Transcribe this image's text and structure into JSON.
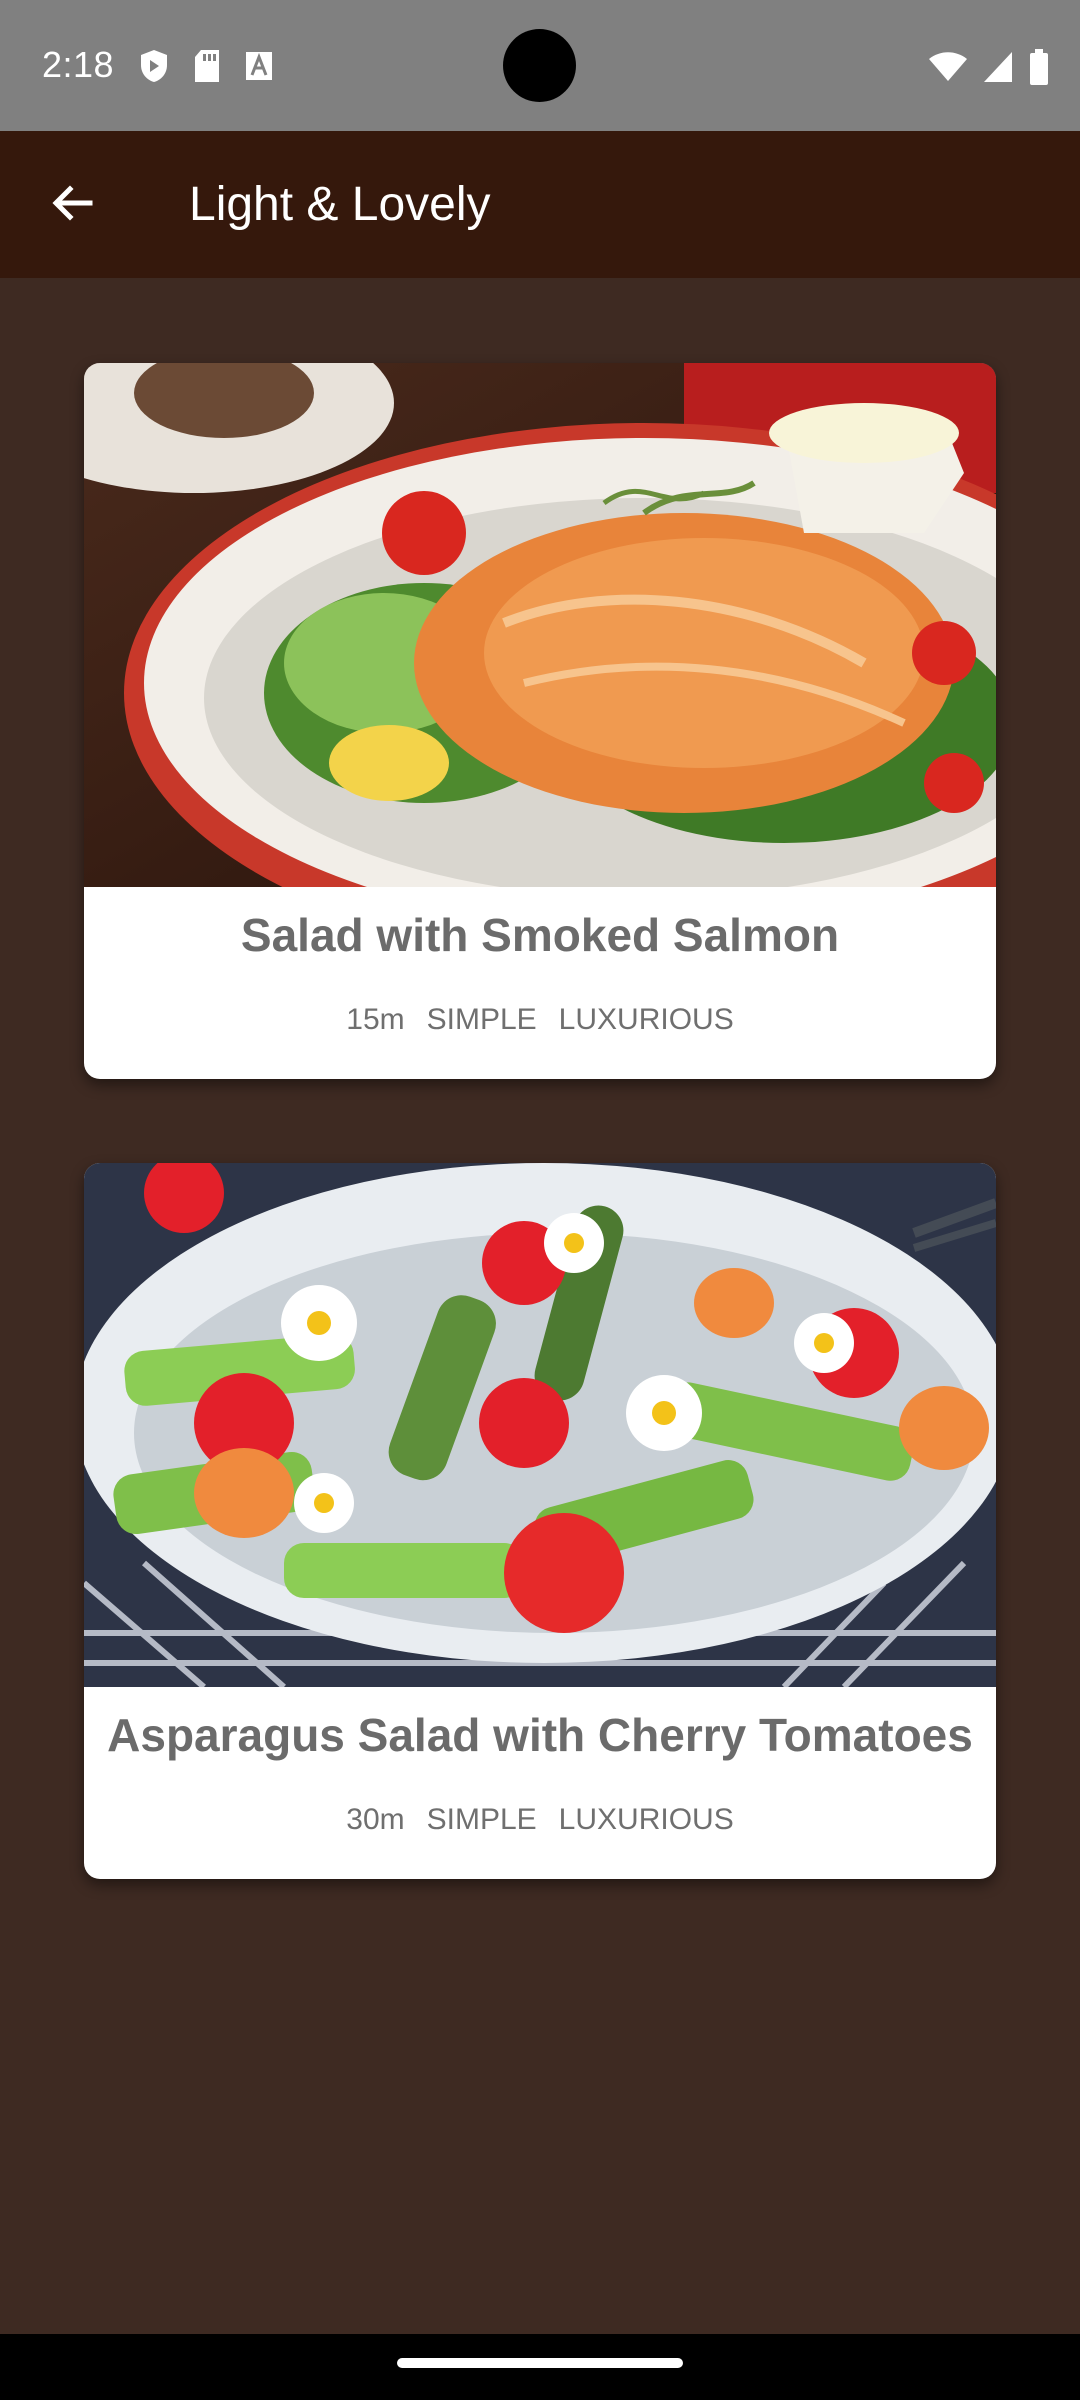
{
  "status_bar": {
    "time": "2:18",
    "left_icons": [
      "shield-icon",
      "sd-card-icon",
      "font-icon"
    ],
    "right_icons": [
      "wifi-icon",
      "cell-signal-icon",
      "battery-icon"
    ]
  },
  "app_bar": {
    "title": "Light & Lovely",
    "background": "#35180c"
  },
  "content": {
    "background": "#3e2a22"
  },
  "meals": [
    {
      "title": "Salad with Smoked Salmon",
      "duration": "15m",
      "complexity": "SIMPLE",
      "affordability": "LUXURIOUS",
      "image_icon": "salmon-salad-image"
    },
    {
      "title": "Asparagus Salad with Cherry Tomatoes",
      "duration": "30m",
      "complexity": "SIMPLE",
      "affordability": "LUXURIOUS",
      "image_icon": "asparagus-salad-image"
    }
  ]
}
